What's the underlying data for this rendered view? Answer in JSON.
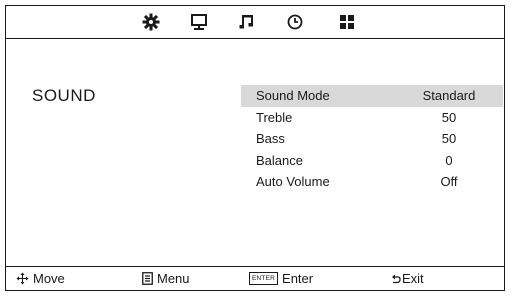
{
  "tabs": [
    {
      "icon": "picture-gear-icon"
    },
    {
      "icon": "monitor-icon"
    },
    {
      "icon": "music-note-icon"
    },
    {
      "icon": "clock-icon"
    },
    {
      "icon": "grid-icon"
    }
  ],
  "section": {
    "title": "SOUND"
  },
  "menu": {
    "items": [
      {
        "label": "Sound Mode",
        "value": "Standard",
        "selected": true
      },
      {
        "label": "Treble",
        "value": "50"
      },
      {
        "label": "Bass",
        "value": "50"
      },
      {
        "label": "Balance",
        "value": "0"
      },
      {
        "label": "Auto Volume",
        "value": "Off"
      }
    ]
  },
  "footer": {
    "move": {
      "icon": "four-way-arrow-icon",
      "label": "Move"
    },
    "menu": {
      "icon": "menu-list-icon",
      "label": "Menu"
    },
    "enter": {
      "key": "ENTER",
      "label": "Enter"
    },
    "exit": {
      "icon": "return-arrow-icon",
      "label": "Exit"
    }
  },
  "colors": {
    "selected_row": "#d9d9d9",
    "line": "#1a1a1a",
    "background": "#ffffff"
  }
}
